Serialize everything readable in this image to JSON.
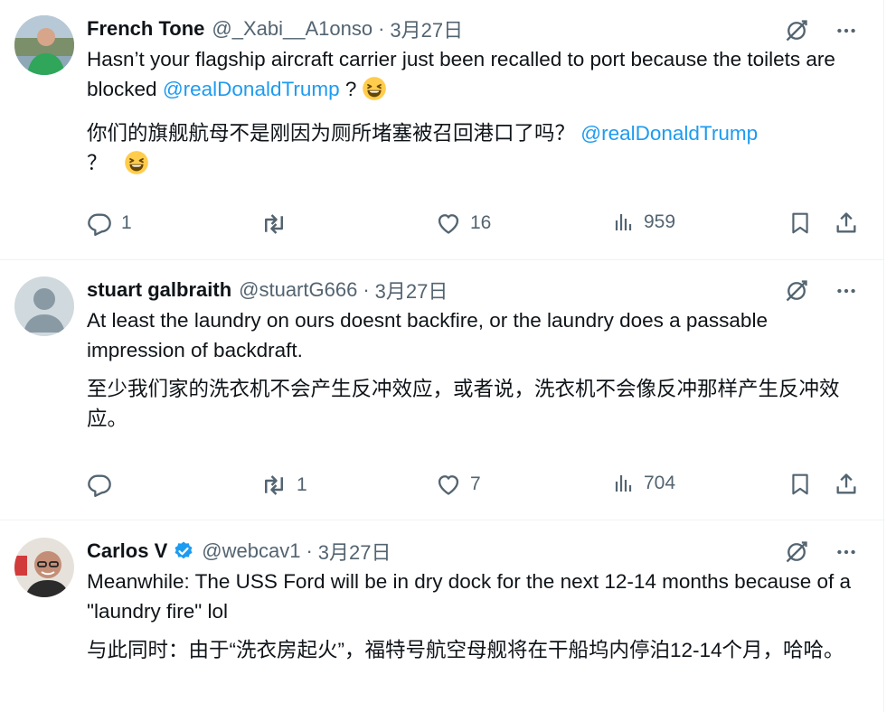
{
  "tweets": [
    {
      "name": "French Tone",
      "handle": "@_Xabi__A1onso",
      "sep": "·",
      "time": "3月27日",
      "verified": false,
      "en_before": "Hasn’t your flagship aircraft carrier just been recalled to port because the toilets are blocked ",
      "en_mention": "@realDonaldTrump",
      "en_after": " ?",
      "zh_before": "你们的旗舰航母不是刚因为厕所堵塞被召回港口了吗？ ",
      "zh_mention": "@realDonaldTrump",
      "zh_after": "？",
      "emoji": "laughing-face",
      "replies": "1",
      "retweets": "",
      "likes": "16",
      "views": "959"
    },
    {
      "name": "stuart galbraith",
      "handle": "@stuartG666",
      "sep": "·",
      "time": "3月27日",
      "verified": false,
      "en": "At least the laundry on ours doesnt backfire, or the laundry does a passable impression of backdraft.",
      "zh": "至少我们家的洗衣机不会产生反冲效应，或者说，洗衣机不会像反冲那样产生反冲效应。",
      "replies": "",
      "retweets": "1",
      "likes": "7",
      "views": "704"
    },
    {
      "name": "Carlos V",
      "handle": "@webcav1",
      "sep": "·",
      "time": "3月27日",
      "verified": true,
      "en": "Meanwhile: The USS Ford will be in dry dock for the next 12-14 months because of a \"laundry fire\" lol",
      "zh": "与此同时：由于“洗衣房起火”，福特号航空母舰将在干船坞内停泊12-14个月，哈哈。"
    }
  ],
  "colors": {
    "text": "#0f1419",
    "secondary": "#536471",
    "link": "#1d9bf0",
    "divider": "#eff3f4",
    "verified": "#1d9bf0"
  },
  "icons": [
    "translate-off-icon",
    "more-icon",
    "reply-icon",
    "retweet-icon",
    "like-icon",
    "views-icon",
    "bookmark-icon",
    "share-icon",
    "verified-badge-icon"
  ]
}
